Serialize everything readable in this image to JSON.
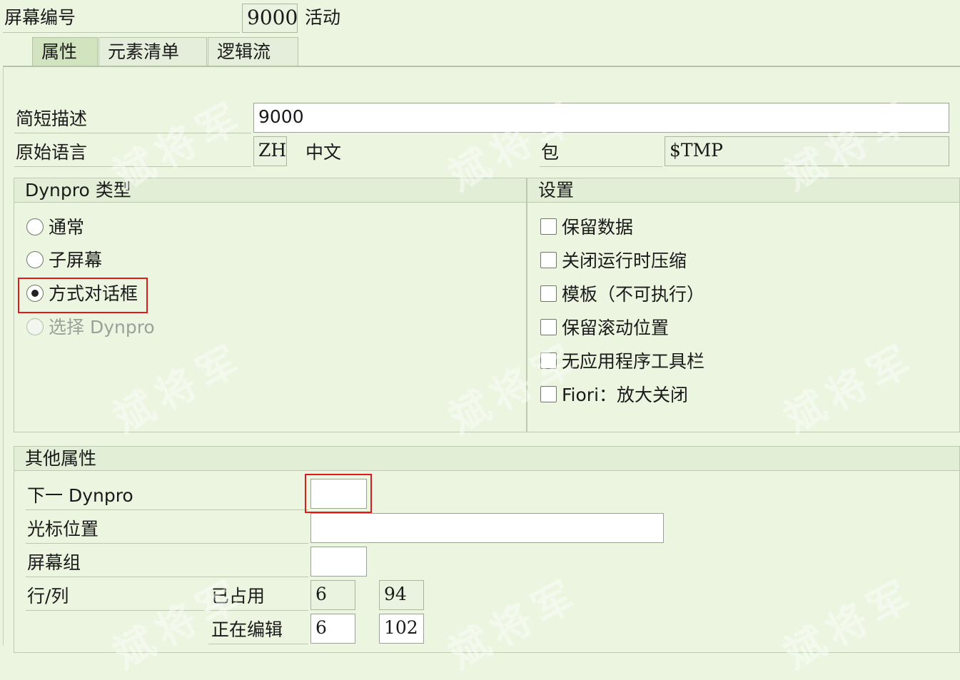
{
  "header": {
    "screen_no_label": "屏幕编号",
    "screen_no_value": "9000",
    "status": "活动"
  },
  "tabs": [
    {
      "label": "属性",
      "active": true
    },
    {
      "label": "元素清单",
      "active": false
    },
    {
      "label": "逻辑流",
      "active": false
    }
  ],
  "attributes": {
    "short_desc_label": "简短描述",
    "short_desc_value": "9000",
    "orig_lang_label": "原始语言",
    "orig_lang_value": "ZH",
    "orig_lang_text": "中文",
    "package_label": "包",
    "package_value": "$TMP"
  },
  "dynpro_type": {
    "title": "Dynpro 类型",
    "options": [
      {
        "label": "通常",
        "selected": false,
        "disabled": false
      },
      {
        "label": "子屏幕",
        "selected": false,
        "disabled": false
      },
      {
        "label": "方式对话框",
        "selected": true,
        "disabled": false
      },
      {
        "label": "选择 Dynpro",
        "selected": false,
        "disabled": true
      }
    ]
  },
  "settings": {
    "title": "设置",
    "options": [
      {
        "label": "保留数据",
        "checked": false
      },
      {
        "label": "关闭运行时压缩",
        "checked": false
      },
      {
        "label": "模板（不可执行）",
        "checked": false
      },
      {
        "label": "保留滚动位置",
        "checked": false
      },
      {
        "label": "无应用程序工具栏",
        "checked": false
      },
      {
        "label": "Fiori：放大关闭",
        "checked": false
      }
    ]
  },
  "other": {
    "title": "其他属性",
    "next_dynpro_label": "下一 Dynpro",
    "next_dynpro_value": "",
    "cursor_pos_label": "光标位置",
    "cursor_pos_value": "",
    "screen_group_label": "屏幕组",
    "screen_group_value": "",
    "rows_cols_label": "行/列",
    "occupied_label": "已占用",
    "occupied_rows": "6",
    "occupied_cols": "94",
    "editing_label": "正在编辑",
    "editing_rows": "6",
    "editing_cols": "102"
  },
  "watermark": "斌将军",
  "colors": {
    "background": "#ecf5e0",
    "highlight": "#e01a1a"
  }
}
